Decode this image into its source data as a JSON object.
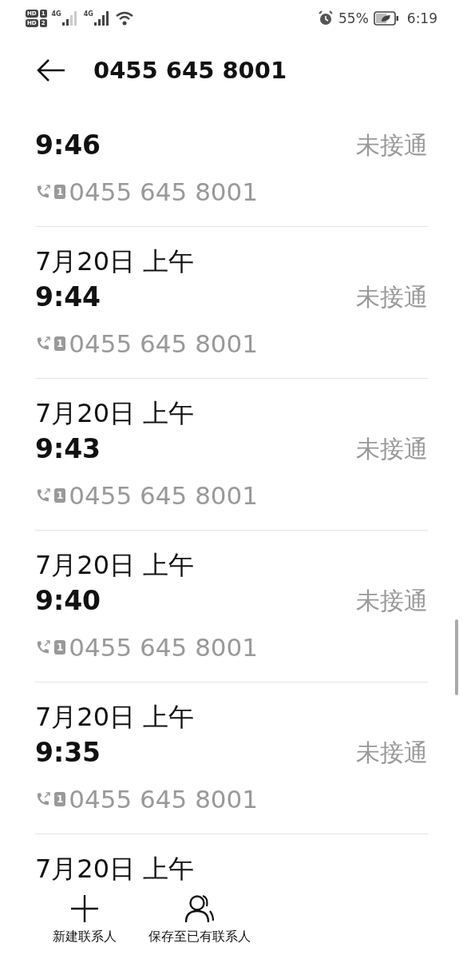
{
  "status_bar": {
    "sims": [
      {
        "label": "HD",
        "slot": "1"
      },
      {
        "label": "HD",
        "slot": "2"
      }
    ],
    "signals": [
      {
        "network": "4G"
      },
      {
        "network": "4G"
      }
    ],
    "battery_percent": "55%",
    "time": "6:19"
  },
  "header": {
    "title": "0455 645 8001"
  },
  "calls": [
    {
      "time": "9:46",
      "status": "未接通",
      "number": "0455 645 8001",
      "sim": "1"
    },
    {
      "date": "7月20日 上午",
      "time": "9:44",
      "status": "未接通",
      "number": "0455 645 8001",
      "sim": "1"
    },
    {
      "date": "7月20日 上午",
      "time": "9:43",
      "status": "未接通",
      "number": "0455 645 8001",
      "sim": "1"
    },
    {
      "date": "7月20日 上午",
      "time": "9:40",
      "status": "未接通",
      "number": "0455 645 8001",
      "sim": "1"
    },
    {
      "date": "7月20日 上午",
      "time": "9:35",
      "status": "未接通",
      "number": "0455 645 8001",
      "sim": "1"
    },
    {
      "date": "7月20日 上午"
    }
  ],
  "actions": [
    {
      "kind": "add",
      "label": "新建联系人"
    },
    {
      "kind": "contact",
      "label": "保存至已有联系人"
    }
  ]
}
